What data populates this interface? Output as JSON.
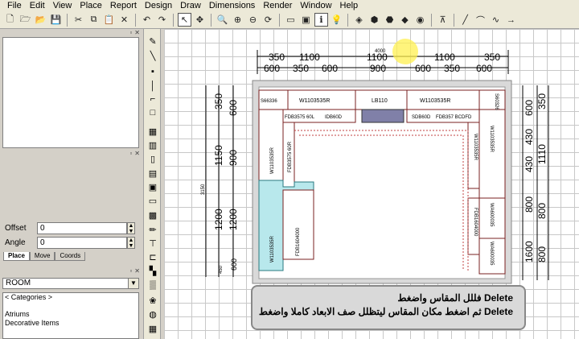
{
  "menu": [
    "File",
    "Edit",
    "View",
    "Place",
    "Report",
    "Design",
    "Draw",
    "Dimensions",
    "Render",
    "Window",
    "Help"
  ],
  "toolbar_icons": [
    "new-icon",
    "open-icon",
    "folder-icon",
    "save-icon",
    "cut-icon",
    "copy-icon",
    "paste-icon",
    "delete-icon",
    "undo-icon",
    "redo-icon",
    "select-icon",
    "pan-icon",
    "zoom-icon",
    "zoom-in-icon",
    "zoom-out-icon",
    "refresh-icon",
    "view-2d-icon",
    "view-3d-icon",
    "info-icon",
    "light-icon",
    "cube-icon",
    "line-icon",
    "arc-icon"
  ],
  "left_panel": {
    "offset_label": "Offset",
    "offset_value": "0",
    "angle_label": "Angle",
    "angle_value": "0",
    "tabs": [
      "Place",
      "Move",
      "Coords"
    ],
    "room_select": "ROOM",
    "categories_header": "< Categories >",
    "categories": [
      "Atriums",
      "Decorative Items"
    ]
  },
  "drawing": {
    "top_dims_row1": [
      "350",
      "1100",
      "1100",
      "1100",
      "350"
    ],
    "top_total": "4000",
    "top_dims_row2": [
      "600",
      "350",
      "600",
      "900",
      "600",
      "350",
      "600"
    ],
    "left_dims_outer": [
      "350",
      "1150",
      "1200"
    ],
    "left_dims_inner": [
      "600",
      "900",
      "1200"
    ],
    "left_total": "3150",
    "left_bottom_small": [
      "450",
      "600"
    ],
    "right_dims_outer": [
      "350",
      "1110",
      "800",
      "800"
    ],
    "right_dims_inner": [
      "600",
      "430",
      "430",
      "800",
      "1600"
    ],
    "cabinet_labels": [
      "S66336",
      "W1103535R",
      "LB110",
      "W1103535R",
      "S60326",
      "FDB3575 60L",
      "IDB60D",
      "SDB60D",
      "FDB357 BCDFD",
      "W1103535R",
      "FDB3575 60R",
      "W1103535R",
      "W1103535R",
      "WA600035",
      "FDB1604000",
      "FDB1604000",
      "WA600035",
      "W1103535R"
    ]
  },
  "caption": {
    "line1": "Delete فللل المقاس واضغط",
    "line2": "Delete ثم اضغط مكان المقاس ليتظلل صف الابعاد كاملا واضغط"
  }
}
